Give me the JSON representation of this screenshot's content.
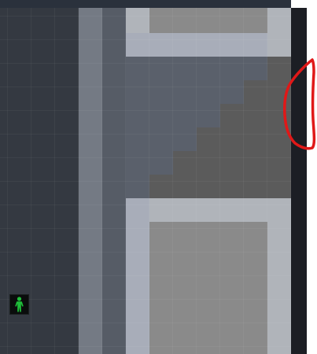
{
  "map": {
    "colors": {
      "top_bar": "#2a313c",
      "floor_dark": "#343941",
      "corridor_light": "#747a84",
      "corridor_mid": "#565c66",
      "room_slate": "#5a606b",
      "room_outer_pale": "#b0b4ba",
      "room_inner_gray": "#8a8a8a",
      "stair_gray": "#5b5b5b",
      "blue_trim": "#a8adb9",
      "right_wall": "#1c1e24",
      "player_bg": "#0a0d0c",
      "player_figure": "#1fbf3a",
      "annotation_stroke": "#e01818"
    }
  },
  "player": {
    "icon": "green-person-icon"
  },
  "annotation": {
    "shape": "red-freehand-loop"
  }
}
